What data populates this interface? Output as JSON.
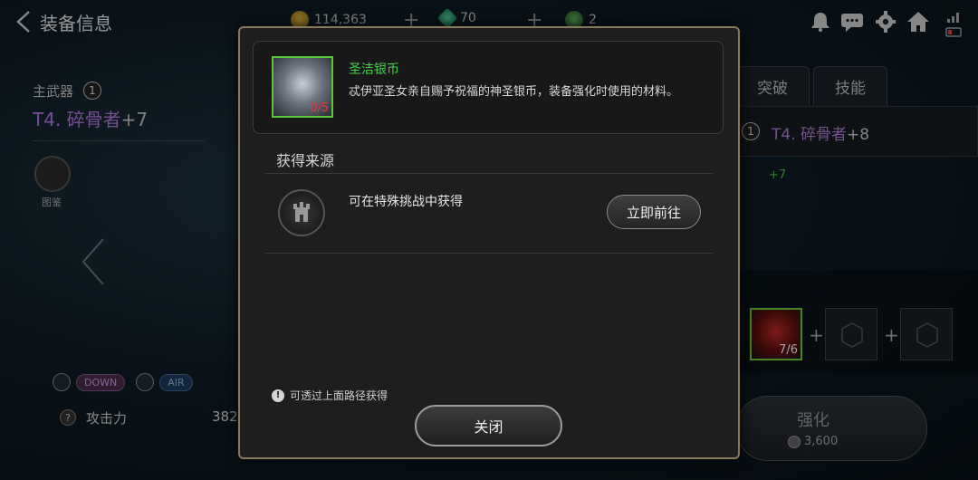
{
  "header": {
    "title": "装备信息",
    "currency": [
      {
        "icon": "gold-coin-icon",
        "amount": "114,363"
      },
      {
        "icon": "green-gem-icon",
        "amount": "70"
      },
      {
        "icon": "stamina-icon",
        "amount": "2"
      }
    ],
    "icons": [
      "bell-icon",
      "chat-icon",
      "gear-icon",
      "home-icon",
      "signal-battery-icon"
    ]
  },
  "left": {
    "slot_label": "主武器",
    "slot_badge": "1",
    "weapon_name": "T4. 碎骨者",
    "weapon_plus": "+7",
    "codex_label": "图鉴",
    "tags": [
      "DOWN",
      "AIR"
    ],
    "attr_icon": "?",
    "attr_label": "攻击力",
    "attr_value": "382"
  },
  "right": {
    "tabs": [
      "突破",
      "技能"
    ],
    "target_badge": "1",
    "target_name": "T4. 碎骨者",
    "target_plus": "+8",
    "plus_level": "+7",
    "material_count": "7/6",
    "enhance_label": "强化",
    "enhance_cost": "3,600"
  },
  "modal": {
    "item_name": "圣洁银币",
    "item_count": "0/5",
    "item_desc": "忒伊亚圣女亲自赐予祝福的神圣银币，装备强化时使用的材料。",
    "source_title": "获得来源",
    "source_text": "可在特殊挑战中获得",
    "go_label": "立即前往",
    "hint_icon": "!",
    "hint_text": "可透过上面路径获得",
    "close_label": "关闭"
  },
  "colors": {
    "accent_purple": "#b57ce0",
    "item_green": "#45d24a",
    "count_red": "#e03a3a",
    "modal_border": "#8b7a5a"
  }
}
